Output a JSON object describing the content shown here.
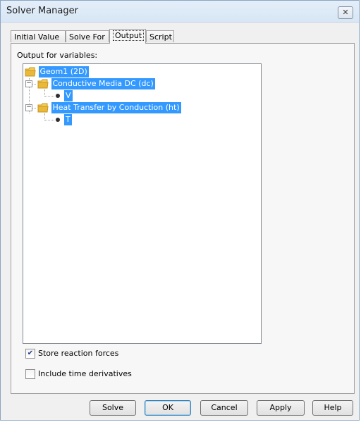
{
  "window": {
    "title": "Solver Manager",
    "close_glyph": "✕"
  },
  "tabs": [
    {
      "label": "Initial Value"
    },
    {
      "label": "Solve For"
    },
    {
      "label": "Output",
      "active": true
    },
    {
      "label": "Script"
    }
  ],
  "output_panel": {
    "label": "Output for variables:",
    "tree": {
      "root": "Geom1 (2D)",
      "groups": [
        {
          "label": "Conductive Media DC (dc)",
          "child": "V"
        },
        {
          "label": "Heat Transfer by Conduction (ht)",
          "child": "T"
        }
      ]
    },
    "options": [
      {
        "label": "Store reaction forces",
        "checked": true
      },
      {
        "label": "Include time derivatives",
        "checked": false
      }
    ]
  },
  "buttons": {
    "solve": "Solve",
    "ok": "OK",
    "cancel": "Cancel",
    "apply": "Apply",
    "help": "Help"
  },
  "colors": {
    "selection": "#3399ff",
    "folder": "#e8b93a"
  },
  "icons": {
    "folder": "folder-icon",
    "variable": "variable-dot-icon",
    "expand": "minus-expander-icon"
  }
}
